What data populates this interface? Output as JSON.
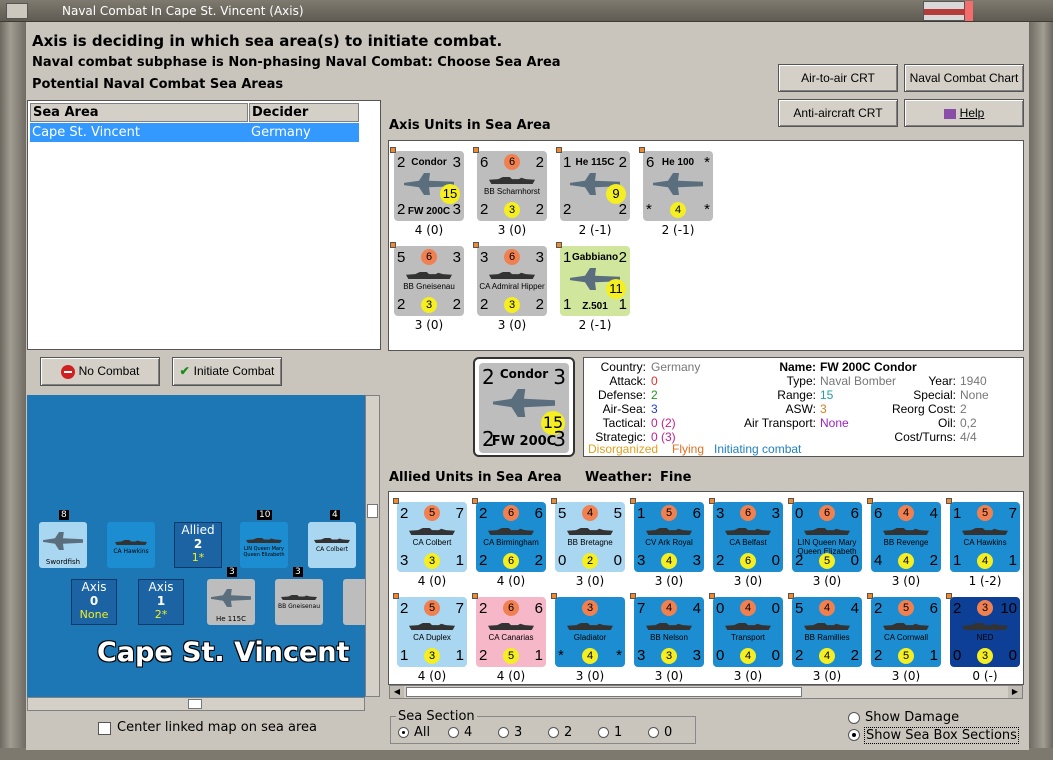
{
  "window": {
    "title": "Naval Combat In Cape St. Vincent (Axis)"
  },
  "header": {
    "line1": "Axis is deciding in which sea area(s) to initiate combat.",
    "line2": "Naval combat subphase is Non-phasing Naval Combat: Choose Sea Area",
    "line3": "Potential Naval Combat Sea Areas"
  },
  "buttons": {
    "air_to_air": "Air-to-air CRT",
    "naval_chart": "Naval Combat Chart",
    "anti_aircraft": "Anti-aircraft CRT",
    "help": "Help",
    "no_combat": "No Combat",
    "initiate_combat": "Initiate Combat"
  },
  "sea_table": {
    "headers": [
      "Sea Area",
      "Decider"
    ],
    "rows": [
      [
        "Cape St. Vincent",
        "Germany"
      ]
    ]
  },
  "axis_units": {
    "title": "Axis Units in Sea Area",
    "units": [
      {
        "tl": "2",
        "tr": "3",
        "bl": "2",
        "br": "3",
        "name": "Condor",
        "sub": "FW 200C",
        "dot": "15",
        "dotc": "yellow",
        "color": "grey",
        "kind": "plane",
        "cap": "4 (0)"
      },
      {
        "tl": "6",
        "tr": "2",
        "bl": "2",
        "br": "2",
        "name": "BB Scharnhorst",
        "top": "6",
        "mid": "3",
        "color": "grey",
        "kind": "ship",
        "cap": "3 (0)"
      },
      {
        "tl": "1",
        "tr": "2",
        "bl": "2",
        "br": "2",
        "name": "He 115C",
        "dot": "9",
        "dotc": "yellow",
        "color": "grey",
        "kind": "plane",
        "cap": "2 (-1)"
      },
      {
        "tl": "6",
        "tr": "*",
        "bl": "*",
        "br": "*",
        "name": "He 100",
        "mid": "4",
        "color": "grey",
        "kind": "plane",
        "cap": "2 (-1)"
      },
      {
        "tl": "5",
        "tr": "3",
        "bl": "2",
        "br": "2",
        "name": "BB Gneisenau",
        "top": "6",
        "mid": "3",
        "color": "grey",
        "kind": "ship",
        "cap": "3 (0)"
      },
      {
        "tl": "3",
        "tr": "3",
        "bl": "2",
        "br": "2",
        "name": "CA Admiral Hipper",
        "top": "6",
        "mid": "3",
        "color": "grey",
        "kind": "ship",
        "cap": "3 (0)"
      },
      {
        "tl": "1",
        "tr": "2",
        "bl": "1",
        "br": "1",
        "name": "Gabbiano",
        "sub": "Z.501",
        "dot": "11",
        "dotc": "yellow",
        "color": "green",
        "kind": "plane",
        "cap": "2 (-1)"
      }
    ]
  },
  "selected_unit": {
    "counter": {
      "tl": "2",
      "tr": "3",
      "bl": "2",
      "br": "3",
      "name": "Condor",
      "sub": "FW 200C",
      "dot": "15"
    },
    "country_label": "Country:",
    "country": "Germany",
    "attack_label": "Attack:",
    "attack": "0",
    "defense_label": "Defense:",
    "defense": "2",
    "airsea_label": "Air-Sea:",
    "airsea": "3",
    "tactical_label": "Tactical:",
    "tactical": "0 (2)",
    "strategic_label": "Strategic:",
    "strategic": "0 (3)",
    "name_label": "Name:",
    "name": "FW 200C Condor",
    "type_label": "Type:",
    "type": "Naval Bomber",
    "year_label": "Year:",
    "year": "1940",
    "range_label": "Range:",
    "range": "15",
    "special_label": "Special:",
    "special": "None",
    "asw_label": "ASW:",
    "asw": "3",
    "reorg_label": "Reorg Cost:",
    "reorg": "2",
    "airtransport_label": "Air Transport:",
    "airtransport": "None",
    "oil_label": "Oil:",
    "oil": "0,2",
    "cost_label": "Cost/Turns:",
    "cost": "4/4",
    "status1": "Disorganized",
    "status2": "Flying",
    "status3": "Initiating combat"
  },
  "allied_units": {
    "title": "Allied Units in Sea Area",
    "weather_label": "Weather:",
    "weather": "Fine",
    "units": [
      {
        "tl": "2",
        "tr": "7",
        "bl": "3",
        "br": "1",
        "name": "CA Colbert",
        "top": "5",
        "mid": "3",
        "color": "lblue",
        "cap": "4 (0)"
      },
      {
        "tl": "2",
        "tr": "6",
        "bl": "2",
        "br": "2",
        "name": "CA Birmingham",
        "top": "6",
        "mid": "6",
        "color": "blue",
        "cap": "4 (0)"
      },
      {
        "tl": "5",
        "tr": "5",
        "bl": "0",
        "br": "0",
        "name": "BB Bretagne",
        "top": "4",
        "mid": "2",
        "color": "lblue",
        "cap": "3 (0)"
      },
      {
        "tl": "1",
        "tr": "6",
        "bl": "3",
        "br": "3",
        "name": "CV Ark Royal",
        "top": "5",
        "mid": "4",
        "color": "blue",
        "cap": "3 (0)"
      },
      {
        "tl": "3",
        "tr": "3",
        "bl": "2",
        "br": "0",
        "name": "CA Belfast",
        "top": "6",
        "mid": "6",
        "color": "blue",
        "cap": "3 (0)"
      },
      {
        "tl": "0",
        "tr": "6",
        "bl": "2",
        "br": "0",
        "name": "LIN Queen Mary Queen Elizabeth",
        "top": "6",
        "mid": "5",
        "color": "blue",
        "cap": "3 (0)"
      },
      {
        "tl": "6",
        "tr": "4",
        "bl": "4",
        "br": "2",
        "name": "BB Revenge",
        "top": "4",
        "mid": "4",
        "color": "blue",
        "cap": "3 (0)"
      },
      {
        "tl": "1",
        "tr": "7",
        "bl": "1",
        "br": "1",
        "name": "CA Hawkins",
        "top": "5",
        "mid": "4",
        "color": "blue",
        "cap": "1 (-2)"
      },
      {
        "tl": "2",
        "tr": "7",
        "bl": "1",
        "br": "1",
        "name": "CA Duplex",
        "top": "5",
        "mid": "3",
        "color": "lblue",
        "cap": "4 (0)"
      },
      {
        "tl": "2",
        "tr": "6",
        "bl": "2",
        "br": "1",
        "name": "CA Canarias",
        "top": "6",
        "mid": "5",
        "color": "pink",
        "cap": "4 (0)"
      },
      {
        "tl": "",
        "tr": "",
        "bl": "*",
        "br": "*",
        "name": "Gladiator",
        "top": "3",
        "mid": "4",
        "color": "blue",
        "cap": "3 (0)"
      },
      {
        "tl": "7",
        "tr": "4",
        "bl": "3",
        "br": "3",
        "name": "BB Nelson",
        "top": "4",
        "mid": "3",
        "color": "blue",
        "cap": "3 (0)"
      },
      {
        "tl": "0",
        "tr": "0",
        "bl": "0",
        "br": "0",
        "name": "Transport",
        "top": "4",
        "mid": "4",
        "color": "blue",
        "cap": "3 (0)"
      },
      {
        "tl": "5",
        "tr": "4",
        "bl": "2",
        "br": "2",
        "name": "BB Ramillies",
        "top": "4",
        "mid": "4",
        "color": "blue",
        "cap": "3 (0)"
      },
      {
        "tl": "2",
        "tr": "6",
        "bl": "2",
        "br": "1",
        "name": "CA Cornwall",
        "top": "5",
        "mid": "5",
        "color": "blue",
        "cap": "3 (0)"
      },
      {
        "tl": "2",
        "tr": "10",
        "bl": "0",
        "br": "0",
        "name": "NED",
        "top": "3",
        "mid": "3",
        "color": "navy",
        "cap": "0 (-)"
      }
    ]
  },
  "map": {
    "name": "Cape St. Vincent",
    "allied_label": "Allied",
    "allied_value": "2",
    "allied_sub": "1*",
    "axis1_label": "Axis",
    "axis1_value": "0",
    "axis1_sub": "None",
    "axis2_label": "Axis",
    "axis2_value": "1",
    "axis2_sub": "2*",
    "stack1": "8",
    "stack2": "10",
    "stack3": "4",
    "stack4": "3",
    "stack5": "3",
    "swordfish": "Swordfish",
    "hawkins": "CA Hawkins",
    "colbert": "CA Colbert",
    "qe": "LIN Queen Mary Queen Elizabeth",
    "he115": "He 115C",
    "gneisenau": "BB Gneisenau"
  },
  "center_map_label": "Center linked map on sea area",
  "sea_section": {
    "label": "Sea Section",
    "options": [
      "All",
      "4",
      "3",
      "2",
      "1",
      "0"
    ]
  },
  "show_damage": "Show Damage",
  "show_sections": "Show Sea Box Sections"
}
